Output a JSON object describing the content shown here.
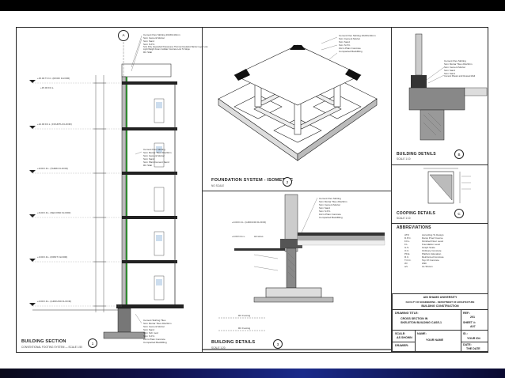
{
  "sheet": {
    "building_section": {
      "title": "BUILDING SECTION",
      "subtitle": "CONVENTIONAL FOOTING SYSTEM — SCALE 1:50",
      "number": "1",
      "grid_label": "A",
      "levels": [
        {
          "label": "+15.00 T.O.C. (ROOF FLOOR)",
          "sub": "+15.00 F.F.L."
        },
        {
          "label": "+12.00 F.F.L. (FOURTH FLOOR)"
        },
        {
          "label": "+9.00 F.F.L. (THIRD FLOOR)"
        },
        {
          "label": "+6.00 F.F.L. (SECOND FLOOR)"
        },
        {
          "label": "+3.00 F.F.L. (FIRST FLOOR)"
        },
        {
          "label": "+0.00 F.F.L. (GROUND FLOOR)"
        }
      ],
      "notes_top": [
        "Cement Flex Skirting 20x60x10mm",
        "Scm Cement Mortar",
        "Scm Sand",
        "Scm S.P.C.",
        "Scm Poly. Expanded Polystyrene Thermal Insulation Barrier Layer Lots",
        "Light Weight Foam Cellular Concrete Lots To Slope",
        "RC Slab"
      ],
      "notes_mid": [
        "Cement Flex Skirting",
        "Scm Mortar Tiles 20x20cm",
        "Scm Cement Mortar",
        "Scm Sand",
        "Scm Plain Cement Sand",
        "RC Slab"
      ],
      "notes_bottom": [
        "Cement Skirting Tiles",
        "Scm Mortar Tiles 20x20cm",
        "Scm Cement Mortar",
        "Scm Sand",
        "Scm Sch mod",
        "Scm S.P.C.",
        "10cm Plain Concrete",
        "Compacted Backfilling"
      ]
    },
    "foundation": {
      "title": "FOUNDATION SYSTEM - ISOMETRIC",
      "subtitle": "NO SCALE",
      "number": "2",
      "notes": [
        "Cement Flex Skirting 20x60x10mm",
        "Scm Cement Mortar",
        "Scm Sand",
        "Scm S.P.C.",
        "10cm Plain Concrete",
        "Compacted Backfilling"
      ]
    },
    "building_details_1": {
      "title": "BUILDING DETAILS",
      "subtitle": "SCALE 1:20",
      "number": "3",
      "levels": [
        "+0.00 F.F.L. (GROUND FLOOR)",
        "+0.00 N.G.L."
      ],
      "notes": [
        "Cement Flex Skirting",
        "Scm Mortar Tiles 20x20cm",
        "Scm Cement Mortar",
        "Scm Sand",
        "Scm S.P.C.",
        "10cm Plain Concrete",
        "Compacted Backfilling"
      ],
      "marks": [
        "RC Footing",
        "RC Footing",
        "Hit wires"
      ]
    },
    "building_details_b": {
      "title": "BUILDING DETAILS",
      "subtitle": "SCALE 1:10",
      "bubble": "B",
      "notes": [
        "Cement Flex Skirting",
        "Scm Mortar Tiles 20x20cm",
        "Scm Cement Mortar",
        "Scm Sand",
        "Scm Sand",
        "Cement Plaster and Dressed Wall"
      ]
    },
    "coping_details": {
      "title": "COOPING DETAILS",
      "subtitle": "SCALE 1:10",
      "bubble": "C"
    },
    "abbreviations": {
      "title": "ABBREVIATIONS",
      "items": [
        {
          "abbr": "ATD",
          "meaning": "According To Design"
        },
        {
          "abbr": "D.P.C.",
          "meaning": "Damp Proof Course"
        },
        {
          "abbr": "F.F.L.",
          "meaning": "Finished Floor Level"
        },
        {
          "abbr": "F.L.",
          "meaning": "Foundation Level"
        },
        {
          "abbr": "G.S.",
          "meaning": "Graph Scale"
        },
        {
          "abbr": "O.C.",
          "meaning": "Ordinary Concrete"
        },
        {
          "abbr": "PF.E.",
          "meaning": "Platform Elevation"
        },
        {
          "abbr": "R.C.",
          "meaning": "Reinforced Concrete"
        },
        {
          "abbr": "T.O.C.",
          "meaning": "Top Of Concrete"
        },
        {
          "abbr": "W/",
          "meaning": "With"
        },
        {
          "abbr": "a/s",
          "meaning": "As Shown"
        }
      ]
    },
    "title_block": {
      "university": "AIN SHAMS UNIVERSITY",
      "faculty": "FACULTY OF ENGINEERING - DEPARTMENT OF ARCHITECTURE",
      "course": "BUILDING CONSTRUCTION",
      "drawing_title_label": "DRAWING TITLE:",
      "drawing_title_1": "CROSS SECTION IN",
      "drawing_title_2": "SKELETON BUILDING CASE-1",
      "ref_label": "REF.:",
      "ref_value": "201",
      "sheet_label": "SHEET #:",
      "sheet_value": "A07",
      "scale_label": "SCALE:",
      "scale_value": "AS SHOWN",
      "name_label": "NAME:",
      "name_value": "YOUR NAME",
      "id_label": "ID.:",
      "id_value": "YOUR ID#",
      "drawer_label": "DRAWER:",
      "date_label": "DATE:",
      "date_value": "THE DATE"
    }
  }
}
